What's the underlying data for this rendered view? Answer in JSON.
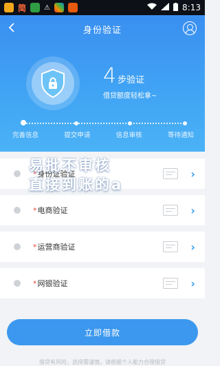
{
  "status_bar": {
    "app_label": "简",
    "time": "8:13"
  },
  "header": {
    "title": "身份验证",
    "step_count": "4",
    "step_label": "步验证",
    "subtitle": "借贷额度轻松拿~"
  },
  "steps": [
    {
      "label": "完善信息"
    },
    {
      "label": "提交申请"
    },
    {
      "label": "信息审核"
    },
    {
      "label": "等待通知"
    }
  ],
  "items": [
    {
      "label": "身份证验证",
      "icon": "id-card-icon"
    },
    {
      "label": "电商验证",
      "icon": "cart-icon"
    },
    {
      "label": "运营商验证",
      "icon": "document-icon"
    },
    {
      "label": "网银验证",
      "icon": "bank-card-icon"
    }
  ],
  "watermark": {
    "line1": "易批不审核",
    "line2": "直接到账的a"
  },
  "cta": {
    "label": "立即借款"
  },
  "footer": {
    "text": "借贷有风险，选择需谨慎，请根据个人能力合理借贷"
  },
  "colors": {
    "brand": "#3a8ff0",
    "button": "#3b98ee",
    "chevron": "#3a9ff0"
  }
}
